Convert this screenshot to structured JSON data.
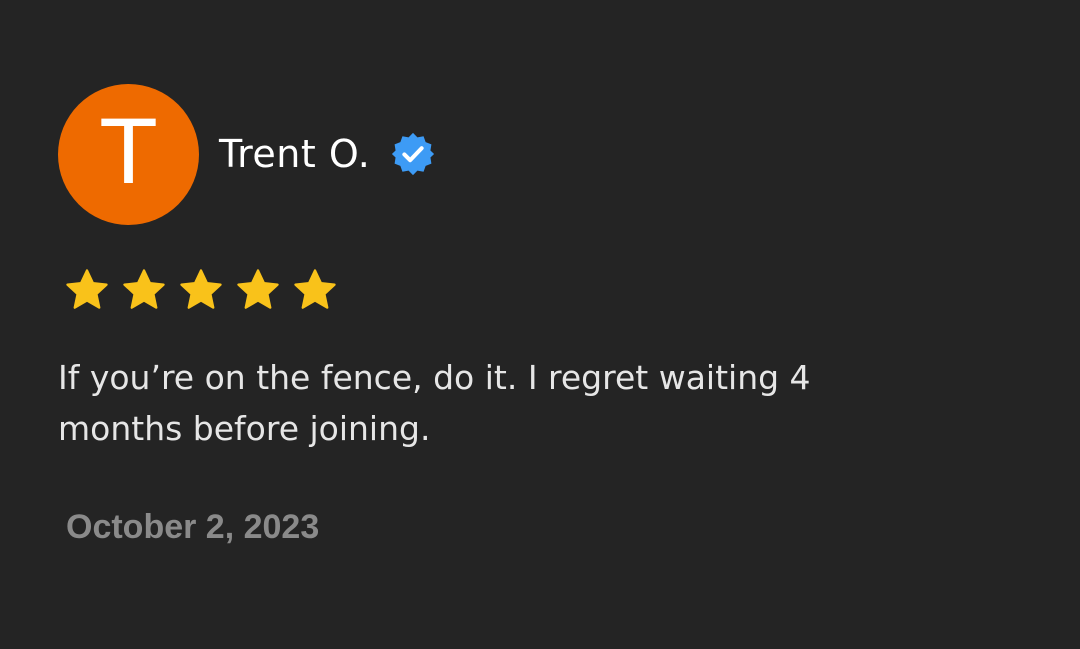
{
  "review": {
    "avatar_initial": "T",
    "avatar_color": "#ee6a00",
    "reviewer_name": "Trent O.",
    "verified_icon": "verified-badge-icon",
    "verified_color": "#3d9bf5",
    "rating": 5,
    "rating_max": 5,
    "star_icon": "star-icon",
    "star_color": "#f9c21a",
    "text": "If you’re on the fence, do it. I regret waiting 4 months before joining.",
    "date": "October 2, 2023"
  }
}
